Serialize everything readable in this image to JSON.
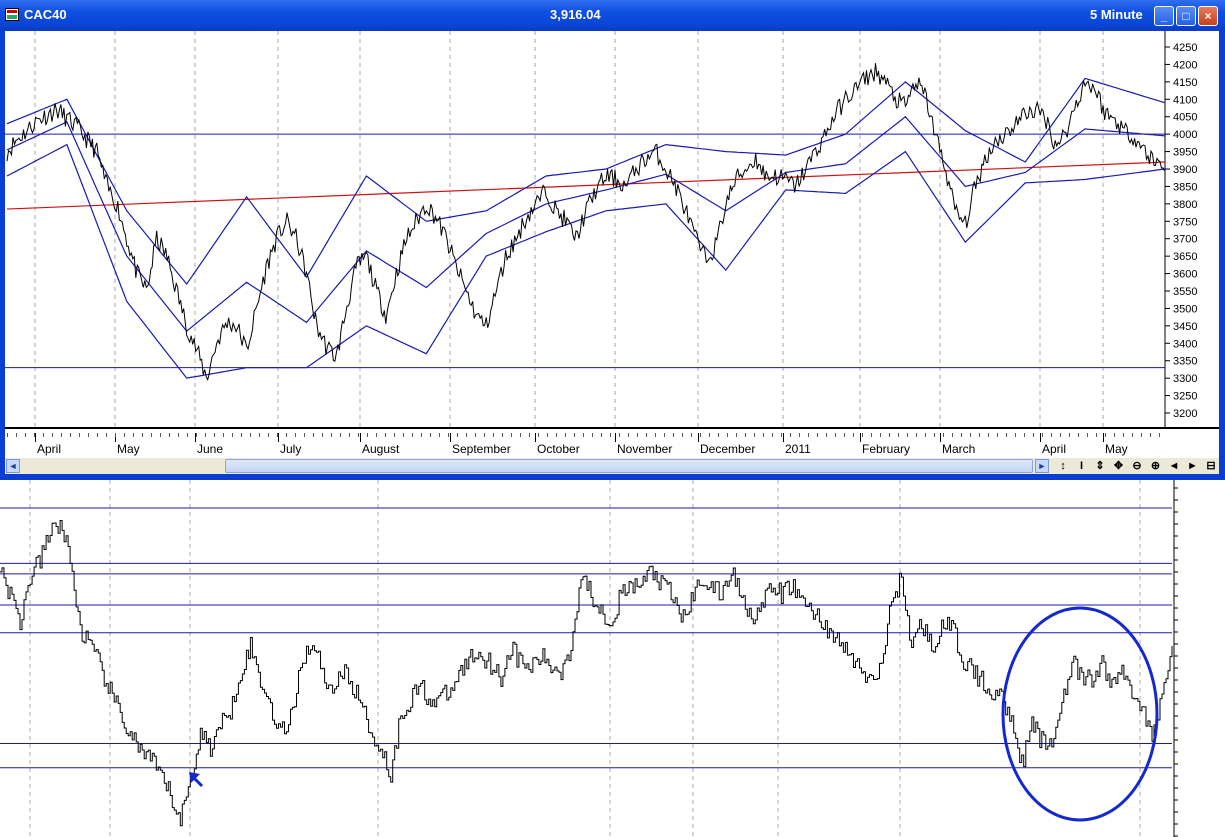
{
  "window": {
    "name": "CAC40",
    "price": "3,916.04",
    "interval": "5 Minute",
    "controls": {
      "minimize": "_",
      "maximize": "□",
      "close": "×"
    }
  },
  "price_axis": {
    "labels": [
      "4250",
      "4200",
      "4150",
      "4100",
      "4050",
      "4000",
      "3950",
      "3900",
      "3850",
      "3800",
      "3750",
      "3700",
      "3650",
      "3600",
      "3550",
      "3500",
      "3450",
      "3400",
      "3350",
      "3300",
      "3250",
      "3200"
    ]
  },
  "time_axis": {
    "labels": [
      "April",
      "May",
      "June",
      "July",
      "August",
      "September",
      "October",
      "November",
      "December",
      "2011",
      "February",
      "March",
      "April",
      "May"
    ]
  },
  "toolbar": {
    "scroll_left": "◄",
    "scroll_right": "►",
    "tools": [
      "↕",
      "I",
      "⇕",
      "✥",
      "⊖",
      "⊕",
      "◄",
      "►",
      "⊟"
    ]
  },
  "colors": {
    "title_bar": "#0a46d8",
    "price_line": "#000000",
    "bands": "#1a1ab0",
    "trend_line": "#d01010",
    "annotation": "#1428d0"
  },
  "annotations": {
    "arrow": "arrow-icon",
    "ellipse": "ellipse-highlight"
  },
  "chart_data": [
    {
      "type": "line",
      "title": "CAC40",
      "y_axis": {
        "range": [
          3200,
          4250
        ],
        "ticks": [
          4250,
          4200,
          4150,
          4100,
          4050,
          4000,
          3950,
          3900,
          3850,
          3800,
          3750,
          3700,
          3650,
          3600,
          3550,
          3500,
          3450,
          3400,
          3350,
          3300,
          3250,
          3200
        ]
      },
      "x_axis": {
        "labels": [
          "April",
          "May",
          "June",
          "July",
          "August",
          "September",
          "October",
          "November",
          "December",
          "2011",
          "February",
          "March",
          "April",
          "May"
        ]
      },
      "horizontal_lines": [
        4000,
        3330
      ],
      "trend_line": {
        "start": 3785,
        "end": 3920
      },
      "series": [
        {
          "x": [
            0,
            10,
            20,
            30,
            40,
            50,
            60,
            70,
            80,
            90,
            100,
            110,
            120,
            130,
            140,
            150,
            160,
            170,
            180,
            190,
            200,
            210,
            220,
            230,
            240,
            250,
            260,
            270,
            280,
            290,
            300,
            310,
            320,
            330,
            340,
            350,
            360,
            370,
            380,
            390,
            400,
            410,
            420,
            430,
            440,
            450,
            460,
            470,
            480,
            490,
            500,
            510,
            520,
            530,
            540,
            550,
            560,
            570,
            580,
            590,
            600,
            610,
            620,
            630,
            640,
            650,
            660,
            670,
            680,
            690,
            700,
            710,
            720,
            730,
            740,
            750,
            760,
            770,
            780,
            790,
            800,
            810,
            820,
            830,
            840,
            850,
            860,
            870,
            880,
            890,
            900,
            910,
            920,
            930,
            940,
            950,
            960,
            970,
            980,
            990,
            1000,
            1010,
            1020,
            1030,
            1040,
            1050,
            1060,
            1070,
            1080,
            1090,
            1100,
            1110,
            1120,
            1130,
            1140,
            1150,
            1160
          ],
          "y": [
            3950,
            3985,
            4010,
            4040,
            4055,
            4070,
            4045,
            4020,
            3985,
            3950,
            3850,
            3800,
            3700,
            3600,
            3550,
            3700,
            3650,
            3550,
            3450,
            3380,
            3300,
            3400,
            3460,
            3450,
            3380,
            3500,
            3620,
            3700,
            3750,
            3700,
            3600,
            3450,
            3390,
            3360,
            3500,
            3620,
            3650,
            3550,
            3480,
            3600,
            3700,
            3750,
            3800,
            3760,
            3700,
            3620,
            3550,
            3480,
            3450,
            3550,
            3650,
            3700,
            3760,
            3800,
            3840,
            3780,
            3750,
            3700,
            3780,
            3840,
            3880,
            3870,
            3850,
            3900,
            3930,
            3950,
            3900,
            3850,
            3780,
            3700,
            3640,
            3680,
            3800,
            3870,
            3900,
            3930,
            3880,
            3880,
            3870,
            3850,
            3900,
            3950,
            4000,
            4060,
            4100,
            4130,
            4160,
            4180,
            4150,
            4100,
            4080,
            4150,
            4110,
            4000,
            3900,
            3780,
            3740,
            3850,
            3930,
            3980,
            4000,
            4030,
            4060,
            4070,
            4050,
            3970,
            4000,
            4080,
            4150,
            4130,
            4060,
            4040,
            4010,
            3990,
            3950,
            3920,
            3910
          ]
        },
        {
          "name": "",
          "x": [
            0,
            60,
            120,
            180,
            240,
            300,
            360,
            420,
            480,
            540,
            600,
            660,
            720,
            780,
            840,
            900,
            960,
            1020,
            1080,
            1160
          ],
          "y": [
            4030,
            4100,
            3780,
            3570,
            3820,
            3590,
            3880,
            3750,
            3780,
            3880,
            3900,
            3970,
            3950,
            3940,
            4000,
            4150,
            4010,
            3920,
            4160,
            4090
          ]
        },
        {
          "name": "",
          "x": [
            0,
            60,
            120,
            180,
            240,
            300,
            360,
            420,
            480,
            540,
            600,
            660,
            720,
            780,
            840,
            900,
            960,
            1020,
            1080,
            1160
          ],
          "y": [
            3880,
            3970,
            3520,
            3300,
            3330,
            3330,
            3450,
            3370,
            3650,
            3720,
            3780,
            3800,
            3610,
            3840,
            3830,
            3950,
            3690,
            3860,
            3870,
            3900
          ]
        }
      ]
    },
    {
      "type": "line",
      "horizontal_lines": [
        0.95,
        0.79,
        0.76,
        0.67,
        0.59,
        0.27,
        0.2
      ],
      "x": [
        0,
        10,
        20,
        30,
        40,
        50,
        60,
        70,
        80,
        90,
        100,
        110,
        120,
        130,
        140,
        150,
        160,
        170,
        180,
        190,
        200,
        210,
        220,
        230,
        240,
        250,
        260,
        270,
        280,
        290,
        300,
        310,
        320,
        330,
        340,
        350,
        360,
        370,
        380,
        390,
        400,
        410,
        420,
        430,
        440,
        450,
        460,
        470,
        480,
        490,
        500,
        510,
        520,
        530,
        540,
        550,
        560,
        570,
        580,
        590,
        600,
        610,
        620,
        630,
        640,
        650,
        660,
        670,
        680,
        690,
        700,
        710,
        720,
        730,
        740,
        750,
        760,
        770,
        780,
        790,
        800,
        810,
        820,
        830,
        840,
        850,
        860,
        870,
        880,
        890,
        900,
        910,
        920,
        930,
        940,
        950,
        960,
        970,
        980,
        990,
        1000,
        1010,
        1020,
        1030,
        1040,
        1050,
        1060,
        1070,
        1080,
        1090,
        1100,
        1110,
        1120,
        1130,
        1140,
        1150,
        1160,
        1170
      ],
      "y": [
        0.78,
        0.7,
        0.62,
        0.75,
        0.8,
        0.88,
        0.91,
        0.8,
        0.6,
        0.55,
        0.49,
        0.42,
        0.35,
        0.3,
        0.25,
        0.22,
        0.18,
        0.12,
        0.05,
        0.16,
        0.3,
        0.26,
        0.32,
        0.37,
        0.48,
        0.55,
        0.45,
        0.38,
        0.3,
        0.34,
        0.5,
        0.56,
        0.5,
        0.42,
        0.48,
        0.45,
        0.39,
        0.3,
        0.26,
        0.18,
        0.35,
        0.4,
        0.44,
        0.39,
        0.4,
        0.42,
        0.48,
        0.52,
        0.53,
        0.5,
        0.46,
        0.55,
        0.5,
        0.49,
        0.52,
        0.49,
        0.48,
        0.55,
        0.76,
        0.7,
        0.66,
        0.62,
        0.7,
        0.72,
        0.73,
        0.77,
        0.73,
        0.7,
        0.63,
        0.68,
        0.75,
        0.72,
        0.7,
        0.77,
        0.7,
        0.64,
        0.66,
        0.72,
        0.7,
        0.73,
        0.68,
        0.66,
        0.62,
        0.59,
        0.55,
        0.52,
        0.48,
        0.44,
        0.5,
        0.68,
        0.75,
        0.55,
        0.62,
        0.55,
        0.6,
        0.61,
        0.52,
        0.48,
        0.45,
        0.42,
        0.4,
        0.35,
        0.21,
        0.32,
        0.28,
        0.26,
        0.4,
        0.5,
        0.46,
        0.45,
        0.5,
        0.44,
        0.48,
        0.42,
        0.38,
        0.28,
        0.4,
        0.58,
        0.62,
        0.68
      ]
    }
  ]
}
